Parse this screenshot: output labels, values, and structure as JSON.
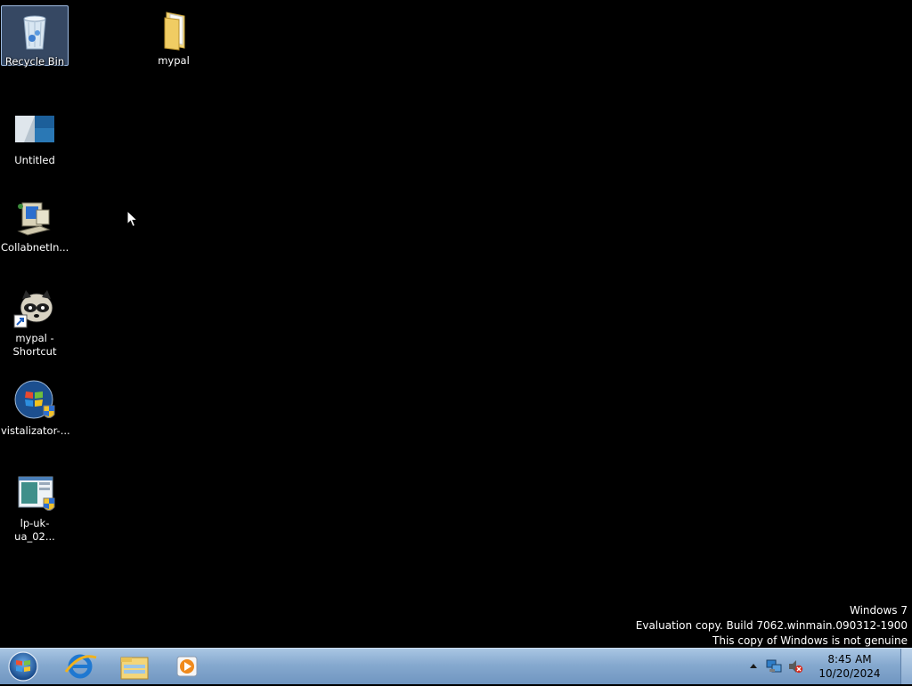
{
  "desktop": {
    "icons": [
      {
        "label": "Recycle Bin"
      },
      {
        "label": "mypal"
      },
      {
        "label": "Untitled"
      },
      {
        "label": "CollabnetIn..."
      },
      {
        "label": "mypal -\nShortcut"
      },
      {
        "label": "vistalizator-..."
      },
      {
        "label": "lp-uk-ua_02..."
      }
    ]
  },
  "watermark": {
    "line1": "Windows 7",
    "line2": "Evaluation copy. Build 7062.winmain.090312-1900",
    "line3": "This copy of Windows is not genuine"
  },
  "taskbar": {
    "pinned": [
      {
        "icon": "internet-explorer-icon"
      },
      {
        "icon": "file-explorer-icon"
      },
      {
        "icon": "media-player-icon"
      }
    ],
    "clock": {
      "time": "8:45 AM",
      "date": "10/20/2024"
    }
  }
}
